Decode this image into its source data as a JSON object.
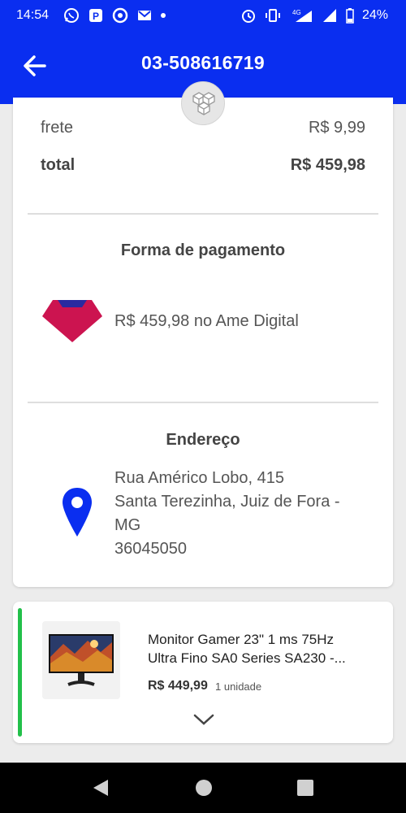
{
  "status_bar": {
    "time": "14:54",
    "network": "4G",
    "battery": "24%"
  },
  "header": {
    "order_id": "03-508616719",
    "back_icon": "arrow-left-icon",
    "badge_icon": "boxes-icon"
  },
  "summary": {
    "frete_label": "frete",
    "frete_value": "R$ 9,99",
    "total_label": "total",
    "total_value": "R$ 459,98"
  },
  "payment": {
    "title": "Forma de pagamento",
    "text": "R$ 459,98 no Ame Digital",
    "logo_icon": "ame-digital-logo"
  },
  "address": {
    "title": "Endereço",
    "line1": "Rua Américo Lobo, 415",
    "line2": "Santa Terezinha, Juiz de Fora -",
    "line3": "MG",
    "line4": "36045050",
    "icon": "location-pin-icon"
  },
  "product": {
    "name_line1": "Monitor Gamer 23\" 1 ms 75Hz",
    "name_line2": "Ultra Fino SA0 Series SA230 -...",
    "price": "R$ 449,99",
    "quantity": "1 unidade",
    "expand_icon": "chevron-down-icon"
  },
  "colors": {
    "header_blue": "#0a2ef0",
    "status_green": "#22c04a",
    "pin_blue": "#0a2ef0",
    "ame_red": "#cc1450"
  }
}
